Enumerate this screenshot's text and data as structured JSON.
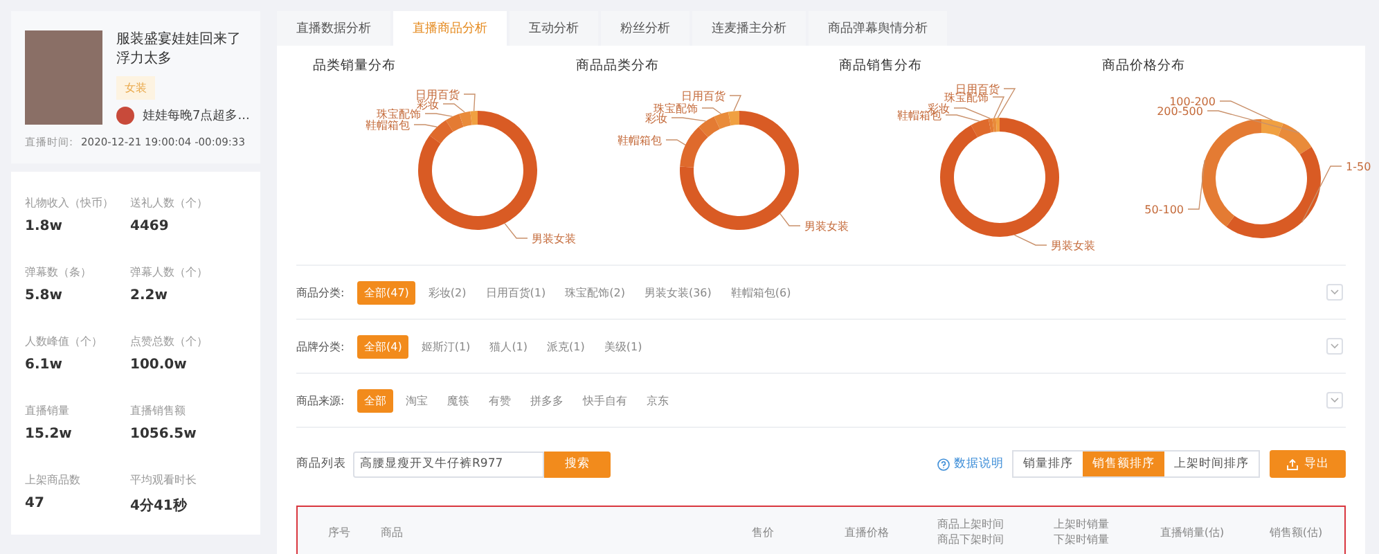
{
  "profile": {
    "title": "服装盛宴娃娃回来了浮力太多",
    "tag": "女装",
    "host": "娃娃每晚7点超多...",
    "time_label": "直播时间:",
    "time_value": "2020-12-21 19:00:04 -00:09:33"
  },
  "stats": [
    {
      "label": "礼物收入（快币）",
      "value": "1.8w"
    },
    {
      "label": "送礼人数（个）",
      "value": "4469"
    },
    {
      "label": "弹幕数（条）",
      "value": "5.8w"
    },
    {
      "label": "弹幕人数（个）",
      "value": "2.2w"
    },
    {
      "label": "人数峰值（个）",
      "value": "6.1w"
    },
    {
      "label": "点赞总数（个）",
      "value": "100.0w"
    },
    {
      "label": "直播销量",
      "value": "15.2w"
    },
    {
      "label": "直播销售额",
      "value": "1056.5w"
    },
    {
      "label": "上架商品数",
      "value": "47"
    },
    {
      "label": "平均观看时长",
      "value": "4分41秒"
    }
  ],
  "tabs": [
    {
      "label": "直播数据分析",
      "selected": false
    },
    {
      "label": "直播商品分析",
      "selected": true
    },
    {
      "label": "互动分析",
      "selected": false
    },
    {
      "label": "粉丝分析",
      "selected": false
    },
    {
      "label": "连麦播主分析",
      "selected": false
    },
    {
      "label": "商品弹幕舆情分析",
      "selected": false
    }
  ],
  "charts": [
    {
      "title": "品类销量分布",
      "labels": [
        "日用百货",
        "彩妆",
        "珠宝配饰",
        "鞋帽箱包",
        "男装女装"
      ]
    },
    {
      "title": "商品品类分布",
      "labels": [
        "日用百货",
        "珠宝配饰",
        "彩妆",
        "鞋帽箱包",
        "男装女装"
      ]
    },
    {
      "title": "商品销售分布",
      "labels": [
        "日用百货",
        "珠宝配饰",
        "彩妆",
        "鞋帽箱包",
        "男装女装"
      ]
    },
    {
      "title": "商品价格分布",
      "labels": [
        "100-200",
        "200-500",
        "1-50",
        "50-100"
      ]
    }
  ],
  "filters": [
    {
      "label": "商品分类:",
      "options": [
        {
          "label": "全部(47)",
          "selected": true
        },
        {
          "label": "彩妆(2)",
          "selected": false
        },
        {
          "label": "日用百货(1)",
          "selected": false
        },
        {
          "label": "珠宝配饰(2)",
          "selected": false
        },
        {
          "label": "男装女装(36)",
          "selected": false
        },
        {
          "label": "鞋帽箱包(6)",
          "selected": false
        }
      ]
    },
    {
      "label": "品牌分类:",
      "options": [
        {
          "label": "全部(4)",
          "selected": true
        },
        {
          "label": "姬斯汀(1)",
          "selected": false
        },
        {
          "label": "猫人(1)",
          "selected": false
        },
        {
          "label": "派克(1)",
          "selected": false
        },
        {
          "label": "美级(1)",
          "selected": false
        }
      ]
    },
    {
      "label": "商品来源:",
      "options": [
        {
          "label": "全部",
          "selected": true
        },
        {
          "label": "淘宝",
          "selected": false
        },
        {
          "label": "魔筷",
          "selected": false
        },
        {
          "label": "有赞",
          "selected": false
        },
        {
          "label": "拼多多",
          "selected": false
        },
        {
          "label": "快手自有",
          "selected": false
        },
        {
          "label": "京东",
          "selected": false
        }
      ]
    }
  ],
  "search": {
    "label": "商品列表",
    "value": "高腰显瘦开叉牛仔裤R977",
    "button": "搜索"
  },
  "help_link": "数据说明",
  "sort_buttons": [
    {
      "label": "销量排序",
      "selected": false
    },
    {
      "label": "销售额排序",
      "selected": true
    },
    {
      "label": "上架时间排序",
      "selected": false
    }
  ],
  "export_button": "导出",
  "table": {
    "columns": [
      {
        "lines": [
          "序号"
        ]
      },
      {
        "lines": [
          "商品"
        ]
      },
      {
        "lines": [
          "售价"
        ]
      },
      {
        "lines": [
          "直播价格"
        ]
      },
      {
        "lines": [
          "商品上架时间",
          "商品下架时间"
        ]
      },
      {
        "lines": [
          "上架时销量",
          "下架时销量"
        ]
      },
      {
        "lines": [
          "直播销量(估)"
        ]
      },
      {
        "lines": [
          "销售额(估)"
        ]
      }
    ]
  }
}
